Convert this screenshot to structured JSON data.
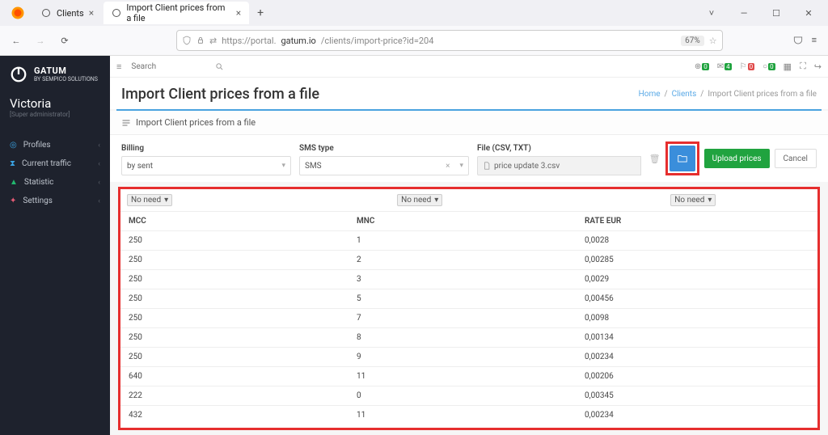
{
  "browser": {
    "tabs": [
      {
        "title": "Clients"
      },
      {
        "title": "Import Client prices from a file"
      }
    ],
    "url_prefix": "https://portal.",
    "url_host": "gatum.io",
    "url_path": "/clients/import-price?id=204",
    "zoom": "67%"
  },
  "sidebar": {
    "brand_main": "GATUM",
    "brand_sub": "BY SEMPICO SOLUTIONS",
    "user_name": "Victoria",
    "user_role": "[Super administrator]",
    "nav": [
      {
        "label": "Profiles"
      },
      {
        "label": "Current traffic"
      },
      {
        "label": "Statistic"
      },
      {
        "label": "Settings"
      }
    ]
  },
  "topbar": {
    "search_placeholder": "Search",
    "badges": [
      {
        "color": "#20a33f",
        "text": "0"
      },
      {
        "color": "#20a33f",
        "text": "4"
      },
      {
        "color": "#e04b4b",
        "text": "0"
      },
      {
        "color": "#20a33f",
        "text": "0"
      }
    ]
  },
  "page": {
    "title": "Import Client prices from a file",
    "breadcrumbs": {
      "home": "Home",
      "clients": "Clients",
      "current": "Import Client prices from a file"
    },
    "panel_title": "Import Client prices from a file"
  },
  "filters": {
    "billing_label": "Billing",
    "billing_value": "by sent",
    "sms_label": "SMS type",
    "sms_value": "SMS",
    "file_label": "File (CSV, TXT)",
    "file_value": "price update 3.csv",
    "upload_label": "Upload prices",
    "cancel_label": "Cancel"
  },
  "table": {
    "noneed": "No need",
    "headers": {
      "c1": "MCC",
      "c2": "MNC",
      "c3": "RATE EUR"
    },
    "rows": [
      {
        "mcc": "250",
        "mnc": "1",
        "rate": "0,0028"
      },
      {
        "mcc": "250",
        "mnc": "2",
        "rate": "0,00285"
      },
      {
        "mcc": "250",
        "mnc": "3",
        "rate": "0,0029"
      },
      {
        "mcc": "250",
        "mnc": "5",
        "rate": "0,00456"
      },
      {
        "mcc": "250",
        "mnc": "7",
        "rate": "0,0098"
      },
      {
        "mcc": "250",
        "mnc": "8",
        "rate": "0,00134"
      },
      {
        "mcc": "250",
        "mnc": "9",
        "rate": "0,00234"
      },
      {
        "mcc": "640",
        "mnc": "11",
        "rate": "0,00206"
      },
      {
        "mcc": "222",
        "mnc": "0",
        "rate": "0,00345"
      },
      {
        "mcc": "432",
        "mnc": "11",
        "rate": "0,00234"
      }
    ]
  }
}
